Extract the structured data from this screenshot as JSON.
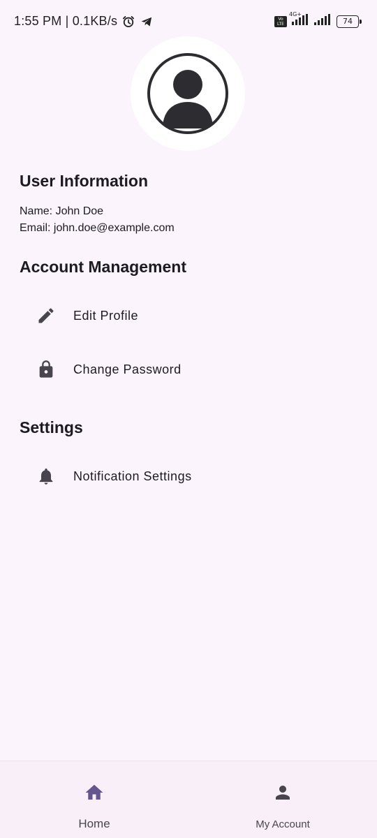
{
  "status_bar": {
    "time_speed": "1:55 PM | 0.1KB/s",
    "volte_top": "Vo",
    "volte_bottom": "LTE",
    "network_label": "4G+",
    "battery": "74"
  },
  "profile": {
    "sections": {
      "user_info": "User Information",
      "account_management": "Account Management",
      "settings": "Settings"
    },
    "name_line": "Name: John Doe",
    "email_line": "Email: john.doe@example.com"
  },
  "menu": {
    "edit_profile": "Edit Profile",
    "change_password": "Change Password",
    "notification_settings": "Notification Settings"
  },
  "bottom_nav": {
    "home": "Home",
    "my_account": "My Account"
  },
  "colors": {
    "background": "#fcf4fc",
    "accent": "#65558f",
    "icon": "#49454f",
    "text": "#1c1b1f"
  },
  "icons": {
    "avatar": "account-circle-icon",
    "edit": "pencil-icon",
    "password": "lock-icon",
    "notifications": "bell-icon",
    "home": "home-icon",
    "account": "person-icon"
  }
}
